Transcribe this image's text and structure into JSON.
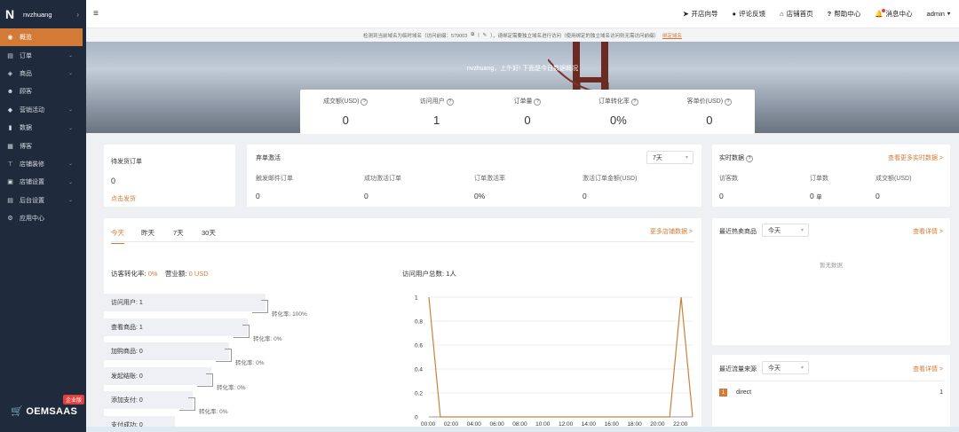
{
  "app": {
    "name": "nvzhuang",
    "brand": "OEMSAAS",
    "brand_tag": "企业版"
  },
  "sidebar": {
    "items": [
      {
        "label": "概览",
        "icon": "dashboard-icon",
        "active": true
      },
      {
        "label": "订单",
        "icon": "order-icon"
      },
      {
        "label": "商品",
        "icon": "product-icon"
      },
      {
        "label": "顾客",
        "icon": "customer-icon"
      },
      {
        "label": "营销活动",
        "icon": "marketing-icon"
      },
      {
        "label": "数据",
        "icon": "chart-icon"
      },
      {
        "label": "博客",
        "icon": "blog-icon"
      },
      {
        "label": "店铺装修",
        "icon": "decorate-icon"
      },
      {
        "label": "店铺设置",
        "icon": "store-settings-icon"
      },
      {
        "label": "后台设置",
        "icon": "admin-settings-icon"
      },
      {
        "label": "应用中心",
        "icon": "app-center-icon"
      }
    ]
  },
  "topbar": {
    "items": [
      "开店向导",
      "评论反馈",
      "店铺首页",
      "帮助中心",
      "消息中心"
    ],
    "user": "admin"
  },
  "notice": {
    "text": "检测到当前域名为临时域名（访问前缀：579003",
    "text2": "），请绑定需要独立域名进行访问（使用绑定的独立域名访问则无需访问前缀）",
    "link": "绑定域名"
  },
  "hero": {
    "greeting": "nvzhuang，上午好! 下面是今日数据概况"
  },
  "kpi": [
    {
      "label": "成交额(USD)",
      "value": "0"
    },
    {
      "label": "访问用户",
      "value": "1"
    },
    {
      "label": "订单量",
      "value": "0"
    },
    {
      "label": "订单转化率",
      "value": "0%"
    },
    {
      "label": "客单价(USD)",
      "value": "0"
    }
  ],
  "pending": {
    "title": "待发货订单",
    "value": "0",
    "link": "点击发货"
  },
  "abandon": {
    "title": "弃单激活",
    "range": "7天",
    "cols": [
      "触发邮件订单",
      "成功激活订单",
      "订单激活率",
      "激活订单金额(USD)"
    ],
    "vals": [
      "0",
      "0",
      "0%",
      "0"
    ]
  },
  "realtime": {
    "title": "实时数据",
    "link": "查看更多实时数据 >",
    "cols": [
      "访客数",
      "订单数",
      "成交额(USD)"
    ],
    "vals": [
      "0",
      "0",
      "0"
    ],
    "unit": "单"
  },
  "store": {
    "tabs": [
      "今天",
      "昨天",
      "7天",
      "30天"
    ],
    "more": "更多店铺数据 >",
    "conv_label": "访客转化率:",
    "conv_value": "0%",
    "sales_label": "营业额:",
    "sales_value": "0 USD",
    "visitors_label": "访问用户总数:",
    "visitors_value": "1人",
    "funnel": [
      {
        "label": "访问用户: 1",
        "rate": "转化率: 100%"
      },
      {
        "label": "查看商品: 1",
        "rate": "转化率: 0%"
      },
      {
        "label": "加购商品: 0",
        "rate": "转化率: 0%"
      },
      {
        "label": "发起结账: 0",
        "rate": "转化率: 0%"
      },
      {
        "label": "添加支付: 0",
        "rate": "转化率: 0%"
      },
      {
        "label": "支付成功: 0",
        "rate": ""
      }
    ]
  },
  "hot": {
    "title": "最近热卖商品",
    "range": "今天",
    "link": "查看详情 >",
    "empty": "暂无数据"
  },
  "traffic": {
    "title": "最近流量来源",
    "range": "今天",
    "link": "查看详情 >",
    "rows": [
      {
        "rank": "1",
        "name": "direct",
        "count": "1"
      }
    ]
  },
  "chart_data": {
    "type": "line",
    "x": [
      "00:00",
      "01:00",
      "02:00",
      "03:00",
      "04:00",
      "05:00",
      "06:00",
      "07:00",
      "08:00",
      "09:00",
      "10:00",
      "11:00",
      "12:00",
      "13:00",
      "14:00",
      "15:00",
      "16:00",
      "17:00",
      "18:00",
      "19:00",
      "20:00",
      "21:00",
      "22:00",
      "23:00"
    ],
    "xticks": [
      "00:00",
      "02:00",
      "04:00",
      "06:00",
      "08:00",
      "10:00",
      "12:00",
      "14:00",
      "16:00",
      "18:00",
      "20:00",
      "22:00"
    ],
    "series": [
      {
        "values": [
          1,
          0,
          0,
          0,
          0,
          0,
          0,
          0,
          0,
          0,
          0,
          0,
          0,
          0,
          0,
          0,
          0,
          0,
          0,
          0,
          0,
          0,
          1,
          0
        ]
      }
    ],
    "yticks": [
      "0",
      "0.2",
      "0.4",
      "0.6",
      "0.8",
      "1"
    ],
    "ylim": [
      0,
      1
    ],
    "color": "#c8823c",
    "grid": true
  }
}
